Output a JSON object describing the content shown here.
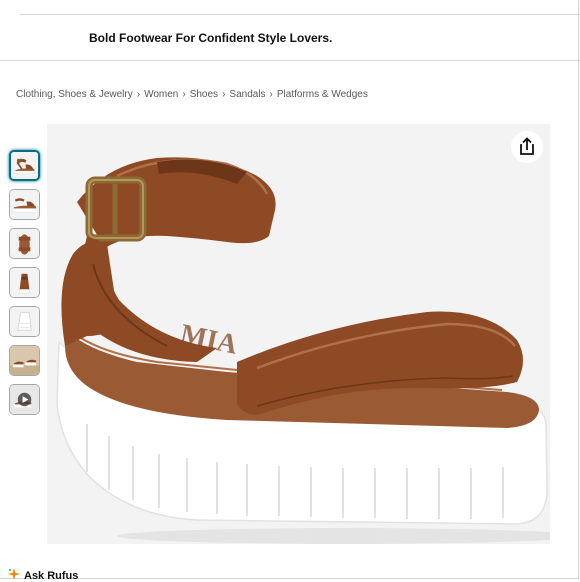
{
  "banner": {
    "text": "Bold Footwear For Confident Style Lovers."
  },
  "breadcrumb": {
    "items": [
      "Clothing, Shoes & Jewelry",
      "Women",
      "Shoes",
      "Sandals",
      "Platforms & Wedges"
    ],
    "separator": "›"
  },
  "gallery": {
    "thumbnail_count": 7,
    "selected_index": 0,
    "thumbnail_views": [
      "side-view",
      "side-view",
      "top-view",
      "front-view",
      "white-detail",
      "lifestyle",
      "video"
    ],
    "share_icon": "share-icon"
  },
  "product_image": {
    "brand_stamp": "MIA"
  },
  "rufus": {
    "label": "Ask Rufus",
    "icon": "sparkle-icon"
  },
  "colors": {
    "leather": "#8e4a24",
    "sole": "#ffffff",
    "footbed": "#9a5a34",
    "buckle": "#8a6a35",
    "selected_border": "#007185"
  }
}
